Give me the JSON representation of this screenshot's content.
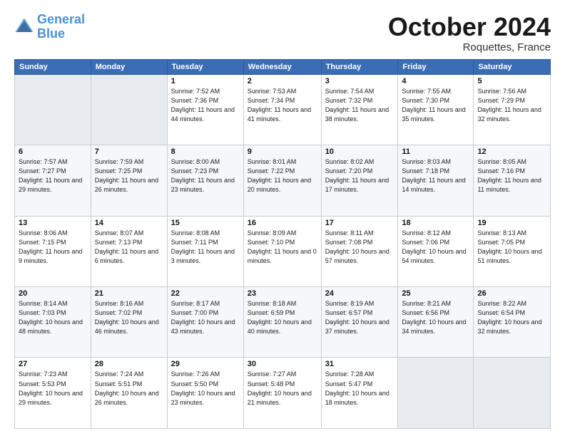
{
  "header": {
    "logo_line1": "General",
    "logo_line2": "Blue",
    "month": "October 2024",
    "location": "Roquettes, France"
  },
  "days_of_week": [
    "Sunday",
    "Monday",
    "Tuesday",
    "Wednesday",
    "Thursday",
    "Friday",
    "Saturday"
  ],
  "weeks": [
    [
      {
        "day": "",
        "info": ""
      },
      {
        "day": "",
        "info": ""
      },
      {
        "day": "1",
        "info": "Sunrise: 7:52 AM\nSunset: 7:36 PM\nDaylight: 11 hours and 44 minutes."
      },
      {
        "day": "2",
        "info": "Sunrise: 7:53 AM\nSunset: 7:34 PM\nDaylight: 11 hours and 41 minutes."
      },
      {
        "day": "3",
        "info": "Sunrise: 7:54 AM\nSunset: 7:32 PM\nDaylight: 11 hours and 38 minutes."
      },
      {
        "day": "4",
        "info": "Sunrise: 7:55 AM\nSunset: 7:30 PM\nDaylight: 11 hours and 35 minutes."
      },
      {
        "day": "5",
        "info": "Sunrise: 7:56 AM\nSunset: 7:29 PM\nDaylight: 11 hours and 32 minutes."
      }
    ],
    [
      {
        "day": "6",
        "info": "Sunrise: 7:57 AM\nSunset: 7:27 PM\nDaylight: 11 hours and 29 minutes."
      },
      {
        "day": "7",
        "info": "Sunrise: 7:59 AM\nSunset: 7:25 PM\nDaylight: 11 hours and 26 minutes."
      },
      {
        "day": "8",
        "info": "Sunrise: 8:00 AM\nSunset: 7:23 PM\nDaylight: 11 hours and 23 minutes."
      },
      {
        "day": "9",
        "info": "Sunrise: 8:01 AM\nSunset: 7:22 PM\nDaylight: 11 hours and 20 minutes."
      },
      {
        "day": "10",
        "info": "Sunrise: 8:02 AM\nSunset: 7:20 PM\nDaylight: 11 hours and 17 minutes."
      },
      {
        "day": "11",
        "info": "Sunrise: 8:03 AM\nSunset: 7:18 PM\nDaylight: 11 hours and 14 minutes."
      },
      {
        "day": "12",
        "info": "Sunrise: 8:05 AM\nSunset: 7:16 PM\nDaylight: 11 hours and 11 minutes."
      }
    ],
    [
      {
        "day": "13",
        "info": "Sunrise: 8:06 AM\nSunset: 7:15 PM\nDaylight: 11 hours and 9 minutes."
      },
      {
        "day": "14",
        "info": "Sunrise: 8:07 AM\nSunset: 7:13 PM\nDaylight: 11 hours and 6 minutes."
      },
      {
        "day": "15",
        "info": "Sunrise: 8:08 AM\nSunset: 7:11 PM\nDaylight: 11 hours and 3 minutes."
      },
      {
        "day": "16",
        "info": "Sunrise: 8:09 AM\nSunset: 7:10 PM\nDaylight: 11 hours and 0 minutes."
      },
      {
        "day": "17",
        "info": "Sunrise: 8:11 AM\nSunset: 7:08 PM\nDaylight: 10 hours and 57 minutes."
      },
      {
        "day": "18",
        "info": "Sunrise: 8:12 AM\nSunset: 7:06 PM\nDaylight: 10 hours and 54 minutes."
      },
      {
        "day": "19",
        "info": "Sunrise: 8:13 AM\nSunset: 7:05 PM\nDaylight: 10 hours and 51 minutes."
      }
    ],
    [
      {
        "day": "20",
        "info": "Sunrise: 8:14 AM\nSunset: 7:03 PM\nDaylight: 10 hours and 48 minutes."
      },
      {
        "day": "21",
        "info": "Sunrise: 8:16 AM\nSunset: 7:02 PM\nDaylight: 10 hours and 46 minutes."
      },
      {
        "day": "22",
        "info": "Sunrise: 8:17 AM\nSunset: 7:00 PM\nDaylight: 10 hours and 43 minutes."
      },
      {
        "day": "23",
        "info": "Sunrise: 8:18 AM\nSunset: 6:59 PM\nDaylight: 10 hours and 40 minutes."
      },
      {
        "day": "24",
        "info": "Sunrise: 8:19 AM\nSunset: 6:57 PM\nDaylight: 10 hours and 37 minutes."
      },
      {
        "day": "25",
        "info": "Sunrise: 8:21 AM\nSunset: 6:56 PM\nDaylight: 10 hours and 34 minutes."
      },
      {
        "day": "26",
        "info": "Sunrise: 8:22 AM\nSunset: 6:54 PM\nDaylight: 10 hours and 32 minutes."
      }
    ],
    [
      {
        "day": "27",
        "info": "Sunrise: 7:23 AM\nSunset: 5:53 PM\nDaylight: 10 hours and 29 minutes."
      },
      {
        "day": "28",
        "info": "Sunrise: 7:24 AM\nSunset: 5:51 PM\nDaylight: 10 hours and 26 minutes."
      },
      {
        "day": "29",
        "info": "Sunrise: 7:26 AM\nSunset: 5:50 PM\nDaylight: 10 hours and 23 minutes."
      },
      {
        "day": "30",
        "info": "Sunrise: 7:27 AM\nSunset: 5:48 PM\nDaylight: 10 hours and 21 minutes."
      },
      {
        "day": "31",
        "info": "Sunrise: 7:28 AM\nSunset: 5:47 PM\nDaylight: 10 hours and 18 minutes."
      },
      {
        "day": "",
        "info": ""
      },
      {
        "day": "",
        "info": ""
      }
    ]
  ]
}
